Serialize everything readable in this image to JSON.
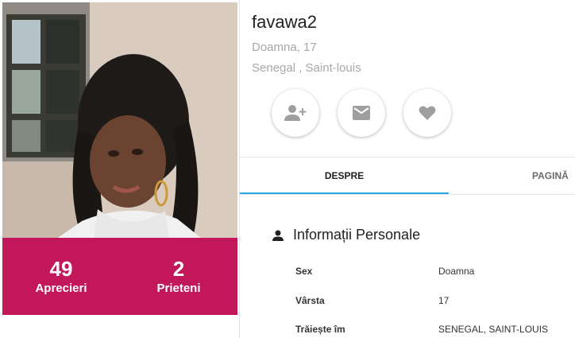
{
  "profile": {
    "username": "favawa2",
    "gender_age": "Doamna, 17",
    "location": "Senegal , Saint-louis"
  },
  "stats": {
    "likes_count": "49",
    "likes_label": "Aprecieri",
    "friends_count": "2",
    "friends_label": "Prieteni"
  },
  "actions": {
    "add_friend_icon": "person-add-icon",
    "message_icon": "mail-icon",
    "like_icon": "heart-icon"
  },
  "tabs": [
    {
      "label": "DESPRE",
      "active": true
    },
    {
      "label": "PAGINĂ",
      "active": false
    }
  ],
  "section": {
    "icon": "person-icon",
    "title": "Informații Personale"
  },
  "info": [
    {
      "label": "Sex",
      "value": "Doamna"
    },
    {
      "label": "Vârsta",
      "value": "17"
    },
    {
      "label": "Trăiește îm",
      "value": "SENEGAL, SAINT-LOUIS"
    }
  ],
  "colors": {
    "stats_bg": "#c2185b",
    "tab_indicator": "#2aa7df",
    "icon_gray": "#9e9e9e"
  }
}
